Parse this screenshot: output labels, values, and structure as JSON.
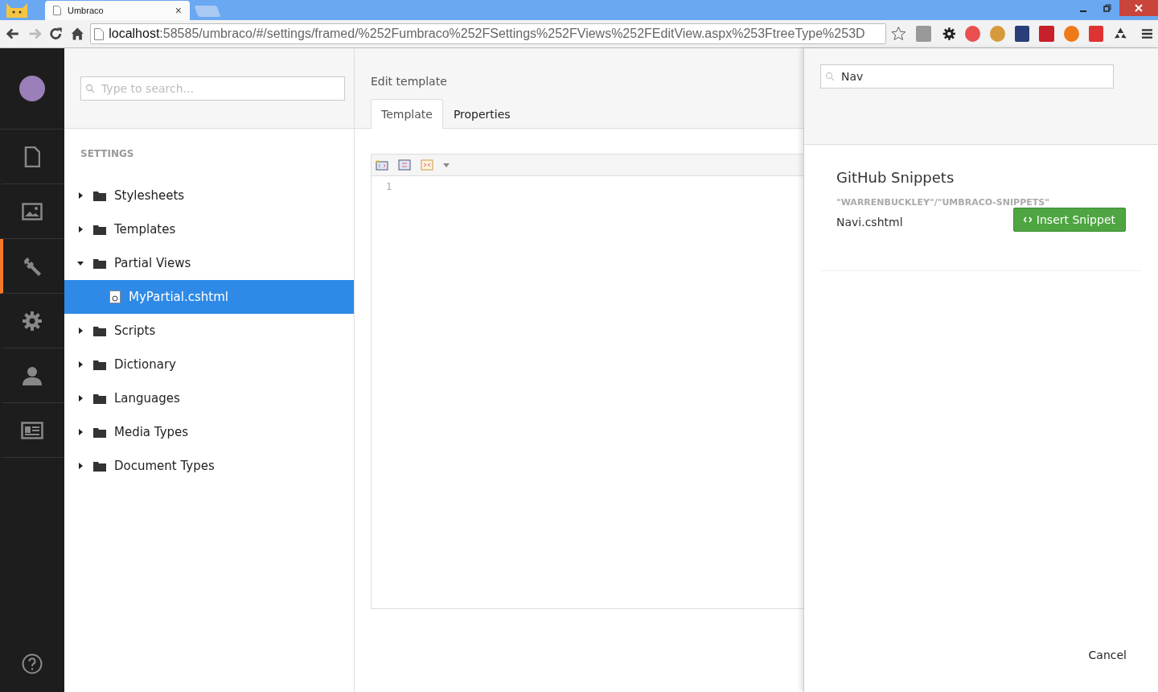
{
  "browser": {
    "tab": {
      "title": "Umbraco",
      "close": "×"
    },
    "url": {
      "host": "localhost",
      "path": ":58585/umbraco/#/settings/framed/%252Fumbraco%252FSettings%252FViews%252FEditView.aspx%253FtreeType%253D"
    }
  },
  "rail": {
    "items": [
      {
        "selected": false
      },
      {
        "selected": false
      },
      {
        "selected": true
      },
      {
        "selected": false
      },
      {
        "selected": false
      },
      {
        "selected": false
      }
    ]
  },
  "tree": {
    "search": {
      "placeholder": "Type to search..."
    },
    "section": "SETTINGS",
    "items": [
      {
        "label": "Stylesheets",
        "expanded": false,
        "selected": false
      },
      {
        "label": "Templates",
        "expanded": false,
        "selected": false
      },
      {
        "label": "Partial Views",
        "expanded": true,
        "selected": false,
        "children": [
          {
            "label": "MyPartial.cshtml",
            "selected": true
          }
        ]
      },
      {
        "label": "Scripts",
        "expanded": false,
        "selected": false
      },
      {
        "label": "Dictionary",
        "expanded": false,
        "selected": false
      },
      {
        "label": "Languages",
        "expanded": false,
        "selected": false
      },
      {
        "label": "Media Types",
        "expanded": false,
        "selected": false
      },
      {
        "label": "Document Types",
        "expanded": false,
        "selected": false
      }
    ]
  },
  "editor": {
    "title": "Edit template",
    "tabs": [
      {
        "label": "Template",
        "selected": true
      },
      {
        "label": "Properties",
        "selected": false
      }
    ],
    "line_numbers": [
      "1"
    ]
  },
  "snippets": {
    "search": {
      "value": "Nav"
    },
    "title": "GitHub Snippets",
    "repo": "\"WARRENBUCKLEY\"/\"UMBRACO-SNIPPETS\"",
    "results": [
      {
        "name": "Navi.cshtml",
        "button": "Insert Snippet"
      }
    ],
    "cancel": "Cancel"
  }
}
